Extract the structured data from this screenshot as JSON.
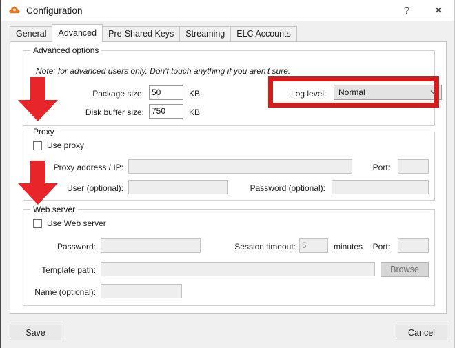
{
  "window": {
    "title": "Configuration",
    "icon": "cloud-icon",
    "help_label": "?",
    "close_label": "✕"
  },
  "tabs": [
    {
      "label": "General",
      "active": false
    },
    {
      "label": "Advanced",
      "active": true
    },
    {
      "label": "Pre-Shared Keys",
      "active": false
    },
    {
      "label": "Streaming",
      "active": false
    },
    {
      "label": "ELC Accounts",
      "active": false
    }
  ],
  "advanced_options": {
    "legend": "Advanced options",
    "note": "Note: for advanced users only. Don't touch anything if you aren't sure.",
    "package_size": {
      "label": "Package size:",
      "value": "50",
      "unit": "KB"
    },
    "disk_buffer_size": {
      "label": "Disk buffer size:",
      "value": "750",
      "unit": "KB"
    },
    "log_level": {
      "label": "Log level:",
      "value": "Normal",
      "arrow": "chevron-down-icon",
      "highlighted": true
    }
  },
  "proxy": {
    "legend": "Proxy",
    "use_proxy": {
      "label": "Use proxy",
      "checked": false
    },
    "address": {
      "label": "Proxy address / IP:",
      "value": "",
      "enabled": false
    },
    "port": {
      "label": "Port:",
      "value": "",
      "enabled": false
    },
    "user": {
      "label": "User (optional):",
      "value": "",
      "enabled": false
    },
    "password": {
      "label": "Password (optional):",
      "value": "",
      "enabled": false
    }
  },
  "web_server": {
    "legend": "Web server",
    "use_web_server": {
      "label": "Use Web server",
      "checked": false
    },
    "password": {
      "label": "Password:",
      "value": "",
      "enabled": false
    },
    "session_timeout": {
      "label": "Session timeout:",
      "value": "5",
      "unit": "minutes",
      "enabled": false
    },
    "port": {
      "label": "Port:",
      "value": "",
      "enabled": false
    },
    "template_path": {
      "label": "Template path:",
      "value": "",
      "enabled": false
    },
    "browse_label": "Browse",
    "name": {
      "label": "Name (optional):",
      "value": "",
      "enabled": false
    }
  },
  "footer": {
    "save_label": "Save",
    "cancel_label": "Cancel"
  },
  "annotations": {
    "highlight_color": "#d61b1b",
    "arrow_color": "#e8262a",
    "arrows": [
      {
        "name": "red-down-arrow-log-level",
        "direction": "down"
      },
      {
        "name": "red-down-arrow-web-server",
        "direction": "down"
      }
    ]
  }
}
